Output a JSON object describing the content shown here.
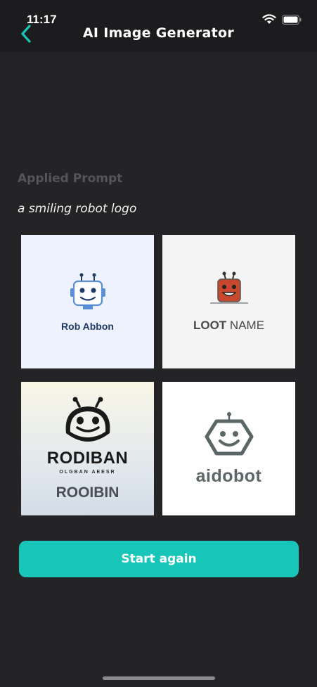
{
  "status_bar": {
    "time": "11:17",
    "icons": [
      "wifi-icon",
      "battery-icon"
    ]
  },
  "header": {
    "back_icon": "chevron-left-icon",
    "title": "AI Image Generator"
  },
  "prompt": {
    "label": "Applied Prompt",
    "text": "a smiling robot logo"
  },
  "results": [
    {
      "lines": [
        "Rob Abbon"
      ]
    },
    {
      "bold": "LOOT",
      "rest": " NAME"
    },
    {
      "lines": [
        "RODIBAN",
        "OLGBAN AEESR",
        "ROOIBIN"
      ]
    },
    {
      "lines": [
        "aidobot"
      ]
    }
  ],
  "actions": {
    "start_again": "Start again"
  },
  "colors": {
    "accent": "#17c6b8",
    "background": "#242426",
    "header": "#1c1c1e"
  }
}
